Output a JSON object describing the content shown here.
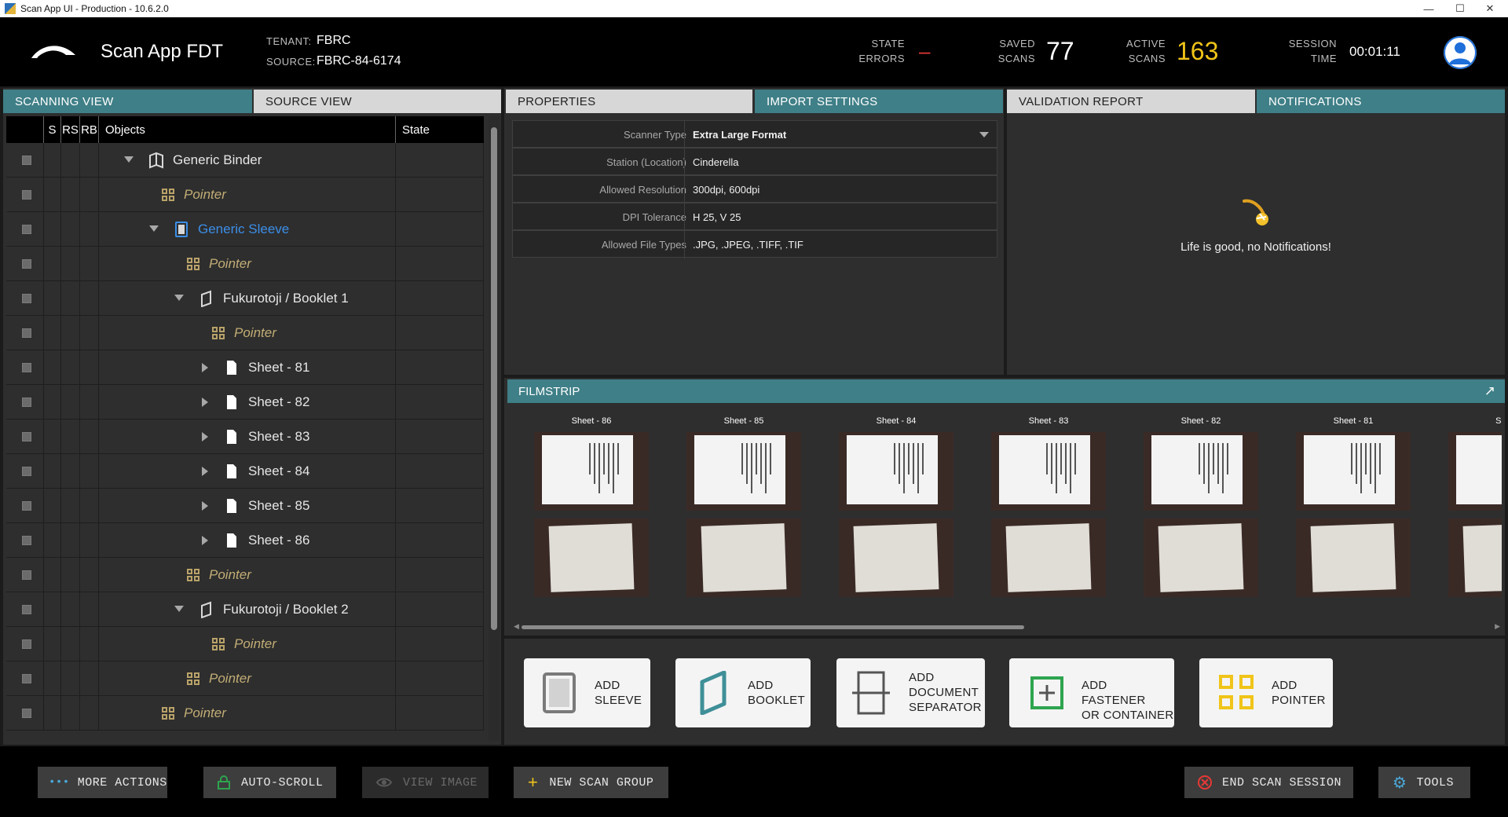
{
  "window": {
    "title": "Scan App UI - Production - 10.6.2.0"
  },
  "header": {
    "app_name": "Scan App FDT",
    "tenant_label": "TENANT:",
    "tenant_value": "FBRC",
    "source_label": "SOURCE:",
    "source_value": "FBRC-84-6174",
    "stats": {
      "state_errors_label_1": "STATE",
      "state_errors_label_2": "ERRORS",
      "state_errors_value": "–",
      "saved_scans_label_1": "SAVED",
      "saved_scans_label_2": "SCANS",
      "saved_scans_value": "77",
      "active_scans_label_1": "ACTIVE",
      "active_scans_label_2": "SCANS",
      "active_scans_value": "163",
      "session_time_label_1": "SESSION",
      "session_time_label_2": "TIME",
      "session_time_value": "00:01:11"
    }
  },
  "left_tabs": {
    "scanning": "SCANNING VIEW",
    "source": "SOURCE VIEW"
  },
  "tree": {
    "columns": {
      "s": "S",
      "rs": "RS",
      "rb": "RB",
      "objects": "Objects",
      "state": "State"
    },
    "rows": [
      {
        "label": "Generic Binder",
        "type": "binder",
        "caret": "down"
      },
      {
        "label": "Pointer",
        "type": "pointer"
      },
      {
        "label": "Generic Sleeve",
        "type": "sleeve",
        "caret": "down"
      },
      {
        "label": "Pointer",
        "type": "pointer"
      },
      {
        "label": "Fukurotoji / Booklet 1",
        "type": "booklet",
        "caret": "down"
      },
      {
        "label": "Pointer",
        "type": "pointer"
      },
      {
        "label": "Sheet -   81",
        "type": "sheet",
        "caret": "right"
      },
      {
        "label": "Sheet -   82",
        "type": "sheet",
        "caret": "right"
      },
      {
        "label": "Sheet -   83",
        "type": "sheet",
        "caret": "right"
      },
      {
        "label": "Sheet -   84",
        "type": "sheet",
        "caret": "right"
      },
      {
        "label": "Sheet -   85",
        "type": "sheet",
        "caret": "right"
      },
      {
        "label": "Sheet -   86",
        "type": "sheet",
        "caret": "right"
      },
      {
        "label": "Pointer",
        "type": "pointer"
      },
      {
        "label": "Fukurotoji / Booklet 2",
        "type": "booklet",
        "caret": "down"
      },
      {
        "label": "Pointer",
        "type": "pointer"
      },
      {
        "label": "Pointer",
        "type": "pointer"
      },
      {
        "label": "Pointer",
        "type": "pointer"
      }
    ]
  },
  "middle_tabs": {
    "properties": "PROPERTIES",
    "import_settings": "IMPORT SETTINGS"
  },
  "import_settings": [
    {
      "key": "Scanner Type",
      "value": "Extra Large Format"
    },
    {
      "key": "Station (Location)",
      "value": "Cinderella"
    },
    {
      "key": "Allowed Resolution",
      "value": "300dpi, 600dpi"
    },
    {
      "key": "DPI Tolerance",
      "value": "H 25, V 25"
    },
    {
      "key": "Allowed File Types",
      "value": ".JPG, .JPEG, .TIFF, .TIF"
    }
  ],
  "right_tabs": {
    "validation": "VALIDATION REPORT",
    "notifications": "NOTIFICATIONS"
  },
  "notifications": {
    "empty_message": "Life is good, no Notifications!"
  },
  "filmstrip": {
    "title": "FILMSTRIP",
    "items": [
      "Sheet - 86",
      "Sheet - 85",
      "Sheet - 84",
      "Sheet - 83",
      "Sheet - 82",
      "Sheet - 81",
      "Shee"
    ]
  },
  "add_buttons": {
    "sleeve_1": "ADD",
    "sleeve_2": "SLEEVE",
    "booklet_1": "ADD",
    "booklet_2": "BOOKLET",
    "separator_1": "ADD",
    "separator_2": "DOCUMENT",
    "separator_3": "SEPARATOR",
    "fastener_1": "ADD FASTENER",
    "fastener_2": "OR CONTAINER",
    "pointer_1": "ADD",
    "pointer_2": "POINTER"
  },
  "bottom_bar": {
    "more_actions": "MORE ACTIONS",
    "auto_scroll": "AUTO-SCROLL",
    "view_image": "VIEW IMAGE",
    "new_scan_group": "NEW SCAN GROUP",
    "end_scan_session": "END SCAN SESSION",
    "tools": "TOOLS"
  },
  "colors": {
    "accent_teal": "#3f7f87",
    "sleeve_blue": "#3b8ee8",
    "pointer_gold": "#c2ad75",
    "active_scans_yellow": "#f0c419",
    "error_red": "#e53935"
  }
}
